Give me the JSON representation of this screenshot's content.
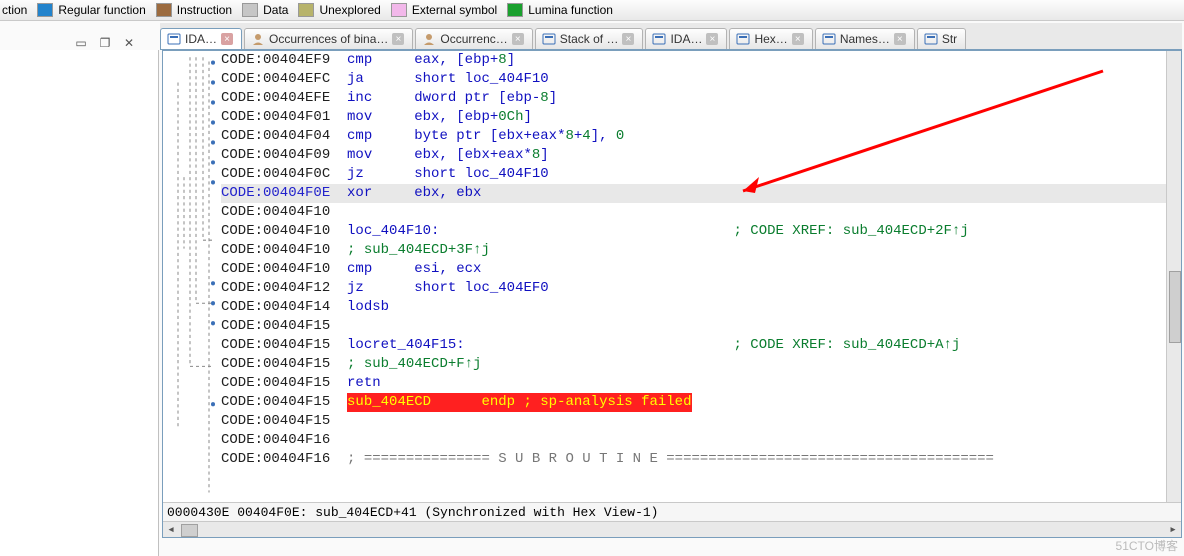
{
  "legend": [
    {
      "label": "ction",
      "color": "#17a2c8",
      "partial": true
    },
    {
      "label": "Regular function",
      "color": "#2283cc"
    },
    {
      "label": "Instruction",
      "color": "#9c6b3f"
    },
    {
      "label": "Data",
      "color": "#c6c6c6"
    },
    {
      "label": "Unexplored",
      "color": "#b7b36b"
    },
    {
      "label": "External symbol",
      "color": "#f2b8ea"
    },
    {
      "label": "Lumina function",
      "color": "#1aa02e"
    }
  ],
  "tabs": [
    {
      "icon": "ida",
      "label": "IDA…",
      "active": true,
      "close": "red"
    },
    {
      "icon": "person",
      "label": "Occurrences of bina…",
      "close": "grey"
    },
    {
      "icon": "person",
      "label": "Occurrenc…",
      "close": "grey"
    },
    {
      "icon": "stack",
      "label": "Stack of …",
      "close": "grey"
    },
    {
      "icon": "ida",
      "label": "IDA…",
      "close": "grey"
    },
    {
      "icon": "hex",
      "label": "Hex…",
      "close": "grey"
    },
    {
      "icon": "names",
      "label": "Names…",
      "close": "grey"
    },
    {
      "icon": "str",
      "label": "Str",
      "close": "none"
    }
  ],
  "code_lines": [
    {
      "addr": "CODE:00404EF9",
      "mnem": "cmp",
      "ops": [
        [
          "op",
          "eax, "
        ],
        [
          "op",
          "[ebp+"
        ],
        [
          "num",
          "8"
        ],
        [
          "op",
          "]"
        ]
      ]
    },
    {
      "addr": "CODE:00404EFC",
      "mnem": "ja",
      "ops": [
        [
          "op",
          "short "
        ],
        [
          "lbl",
          "loc_404F10"
        ]
      ]
    },
    {
      "addr": "CODE:00404EFE",
      "mnem": "inc",
      "ops": [
        [
          "op",
          "dword ptr [ebp-"
        ],
        [
          "num",
          "8"
        ],
        [
          "op",
          "]"
        ]
      ]
    },
    {
      "addr": "CODE:00404F01",
      "mnem": "mov",
      "ops": [
        [
          "op",
          "ebx, [ebp+"
        ],
        [
          "num",
          "0Ch"
        ],
        [
          "op",
          "]"
        ]
      ]
    },
    {
      "addr": "CODE:00404F04",
      "mnem": "cmp",
      "ops": [
        [
          "op",
          "byte ptr [ebx+eax*"
        ],
        [
          "num",
          "8"
        ],
        [
          "op",
          "+"
        ],
        [
          "num",
          "4"
        ],
        [
          "op",
          "], "
        ],
        [
          "num",
          "0"
        ]
      ]
    },
    {
      "addr": "CODE:00404F09",
      "mnem": "mov",
      "ops": [
        [
          "op",
          "ebx, [ebx+eax*"
        ],
        [
          "num",
          "8"
        ],
        [
          "op",
          "]"
        ]
      ]
    },
    {
      "addr": "CODE:00404F0C",
      "mnem": "jz",
      "ops": [
        [
          "op",
          "short "
        ],
        [
          "lbl",
          "loc_404F10"
        ]
      ]
    },
    {
      "addr": "CODE:00404F0E",
      "sel": true,
      "mnem": "xor",
      "ops": [
        [
          "op",
          "ebx, ebx"
        ]
      ]
    },
    {
      "addr": "CODE:00404F10"
    },
    {
      "addr": "CODE:00404F10",
      "label": "loc_404F10:",
      "cmt": "; CODE XREF: sub_404ECD+2F↑j"
    },
    {
      "addr": "CODE:00404F10",
      "cmt": "; sub_404ECD+3F↑j"
    },
    {
      "addr": "CODE:00404F10",
      "mnem": "cmp",
      "ops": [
        [
          "op",
          "esi, ecx"
        ]
      ]
    },
    {
      "addr": "CODE:00404F12",
      "mnem": "jz",
      "ops": [
        [
          "op",
          "short "
        ],
        [
          "lbl",
          "loc_404EF0"
        ]
      ]
    },
    {
      "addr": "CODE:00404F14",
      "mnem": "lodsb"
    },
    {
      "addr": "CODE:00404F15"
    },
    {
      "addr": "CODE:00404F15",
      "label": "locret_404F15:",
      "cmt": "; CODE XREF: sub_404ECD+A↑j"
    },
    {
      "addr": "CODE:00404F15",
      "cmt": "; sub_404ECD+F↑j"
    },
    {
      "addr": "CODE:00404F15",
      "mnem": "retn"
    },
    {
      "addr": "CODE:00404F15",
      "hl": "sub_404ECD      endp ; sp-analysis failed"
    },
    {
      "addr": "CODE:00404F15"
    },
    {
      "addr": "CODE:00404F16"
    },
    {
      "addr": "CODE:00404F16",
      "subr": "; =============== S U B R O U T I N E ======================================="
    }
  ],
  "status": "0000430E 00404F0E: sub_404ECD+41 (Synchronized with Hex View-1)",
  "watermark": "51CTO博客",
  "column_positions": {
    "addr_pad": 0,
    "label": 15,
    "mnem": 32,
    "ops": 40,
    "cmt": 61
  }
}
